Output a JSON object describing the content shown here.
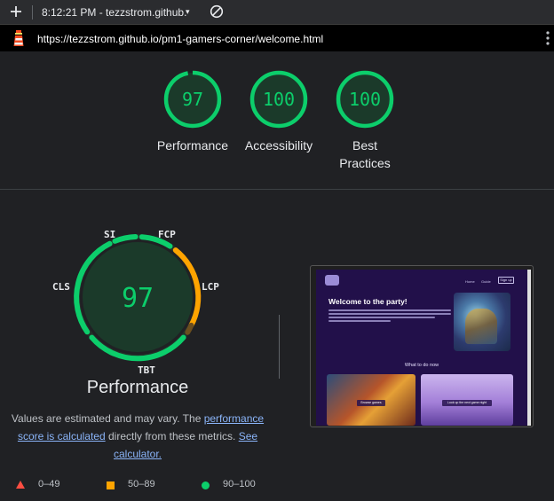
{
  "toolbar": {
    "title": "8:12:21 PM - tezzstrom.github.",
    "caret": "▾",
    "icons": {
      "new": "plus-icon",
      "dropdown": "chevron-down-icon",
      "block": "block-icon"
    }
  },
  "urlbar": {
    "url": "https://tezzstrom.github.io/pm1-gamers-corner/welcome.html",
    "icons": {
      "lighthouse": "lighthouse-icon",
      "menu": "kebab-menu-icon"
    }
  },
  "scores": [
    {
      "label": "Performance",
      "value": "97",
      "percent": 97
    },
    {
      "label": "Accessibility",
      "value": "100",
      "percent": 100
    },
    {
      "label": "Best\nPractices",
      "value": "100",
      "percent": 100
    }
  ],
  "performance": {
    "score": "97",
    "title": "Performance",
    "metrics": {
      "si": "SI",
      "fcp": "FCP",
      "lcp": "LCP",
      "tbt": "TBT",
      "cls": "CLS"
    },
    "note_start": "Values are estimated and may vary. The ",
    "note_link1": "performance score is calculated",
    "note_mid": " directly from these metrics. ",
    "note_link2": "See calculator."
  },
  "screenshot": {
    "nav_links": [
      "Home",
      "Guide"
    ],
    "signup": "Sign up",
    "heading": "Welcome to the party!",
    "subheading": "What to do now",
    "card1_button": "Browse games",
    "card2_button": "Look up the next game night"
  },
  "legend": [
    {
      "range": "0–49",
      "color": "#ff4e42",
      "shape": "triangle"
    },
    {
      "range": "50–89",
      "color": "#ffa400",
      "shape": "square"
    },
    {
      "range": "90–100",
      "color": "#0cce6b",
      "shape": "circle"
    }
  ],
  "colors": {
    "pass": "#0cce6b",
    "average": "#ffa400",
    "fail": "#ff4e42",
    "gauge_fill": "#1b3a2a",
    "link": "#8ab4f8"
  }
}
